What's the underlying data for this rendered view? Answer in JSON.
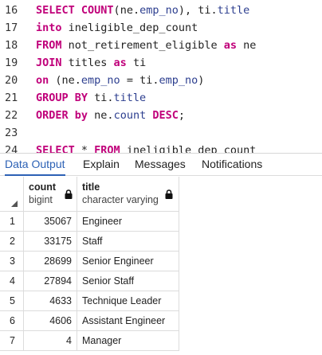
{
  "editor": {
    "lines": [
      {
        "num": "16",
        "tokens": [
          {
            "t": "SELECT COUNT",
            "c": "kw"
          },
          {
            "t": "(",
            "c": "sym"
          },
          {
            "t": "ne.",
            "c": "sym"
          },
          {
            "t": "emp_no",
            "c": "id"
          },
          {
            "t": "), ti.",
            "c": "sym"
          },
          {
            "t": "title",
            "c": "id"
          }
        ]
      },
      {
        "num": "17",
        "tokens": [
          {
            "t": "into",
            "c": "kw"
          },
          {
            "t": " ineligible_dep_count",
            "c": "sym"
          }
        ]
      },
      {
        "num": "18",
        "tokens": [
          {
            "t": "FROM",
            "c": "kw"
          },
          {
            "t": " not_retirement_eligible ",
            "c": "sym"
          },
          {
            "t": "as",
            "c": "kw"
          },
          {
            "t": " ne",
            "c": "sym"
          }
        ]
      },
      {
        "num": "19",
        "tokens": [
          {
            "t": "JOIN",
            "c": "kw"
          },
          {
            "t": " titles ",
            "c": "sym"
          },
          {
            "t": "as",
            "c": "kw"
          },
          {
            "t": " ti",
            "c": "sym"
          }
        ]
      },
      {
        "num": "20",
        "tokens": [
          {
            "t": "on",
            "c": "kw"
          },
          {
            "t": " (ne.",
            "c": "sym"
          },
          {
            "t": "emp_no",
            "c": "id"
          },
          {
            "t": " = ti.",
            "c": "sym"
          },
          {
            "t": "emp_no",
            "c": "id"
          },
          {
            "t": ")",
            "c": "sym"
          }
        ]
      },
      {
        "num": "21",
        "tokens": [
          {
            "t": "GROUP BY",
            "c": "kw"
          },
          {
            "t": " ti.",
            "c": "sym"
          },
          {
            "t": "title",
            "c": "id"
          }
        ]
      },
      {
        "num": "22",
        "tokens": [
          {
            "t": "ORDER",
            "c": "kw"
          },
          {
            "t": " ",
            "c": "sym"
          },
          {
            "t": "by",
            "c": "kw"
          },
          {
            "t": " ne.",
            "c": "sym"
          },
          {
            "t": "count",
            "c": "id"
          },
          {
            "t": " ",
            "c": "sym"
          },
          {
            "t": "DESC",
            "c": "kw"
          },
          {
            "t": ";",
            "c": "sym"
          }
        ]
      },
      {
        "num": "23",
        "tokens": []
      },
      {
        "num": "24",
        "tokens": [
          {
            "t": "SELECT",
            "c": "kw"
          },
          {
            "t": " * ",
            "c": "sym"
          },
          {
            "t": "FROM",
            "c": "kw"
          },
          {
            "t": " ineligible_dep_count",
            "c": "sym"
          }
        ]
      }
    ]
  },
  "tabs": [
    {
      "label": "Data Output",
      "active": true
    },
    {
      "label": "Explain",
      "active": false
    },
    {
      "label": "Messages",
      "active": false
    },
    {
      "label": "Notifications",
      "active": false
    }
  ],
  "grid": {
    "columns": [
      {
        "name": "count",
        "type": "bigint",
        "align": "right"
      },
      {
        "name": "title",
        "type": "character varying",
        "align": "left"
      }
    ],
    "rows": [
      {
        "n": "1",
        "cells": [
          "35067",
          "Engineer"
        ]
      },
      {
        "n": "2",
        "cells": [
          "33175",
          "Staff"
        ]
      },
      {
        "n": "3",
        "cells": [
          "28699",
          "Senior Engineer"
        ]
      },
      {
        "n": "4",
        "cells": [
          "27894",
          "Senior Staff"
        ]
      },
      {
        "n": "5",
        "cells": [
          "4633",
          "Technique Leader"
        ]
      },
      {
        "n": "6",
        "cells": [
          "4606",
          "Assistant Engineer"
        ]
      },
      {
        "n": "7",
        "cells": [
          "4",
          "Manager"
        ]
      }
    ]
  }
}
